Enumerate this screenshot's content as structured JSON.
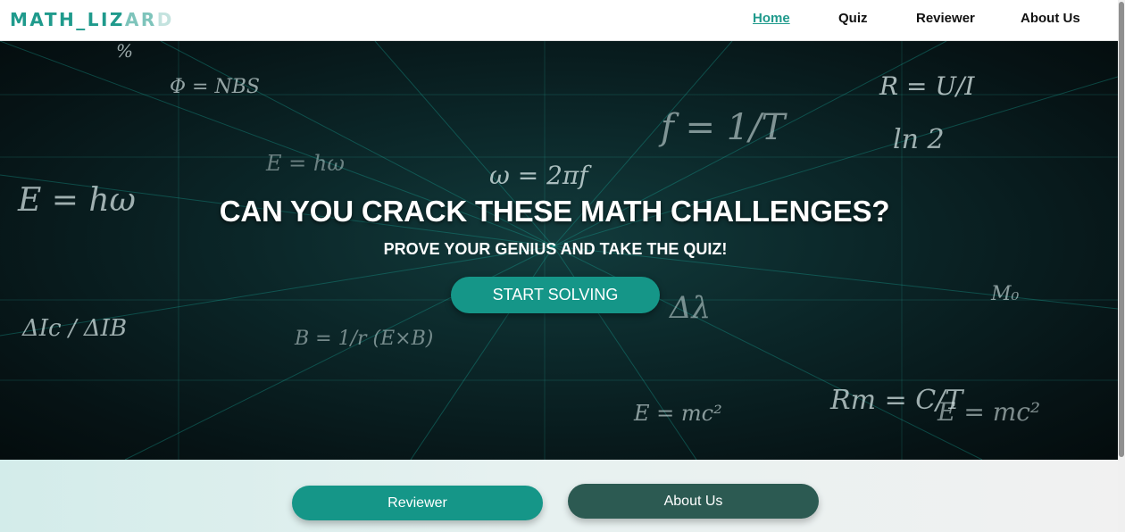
{
  "header": {
    "logo_main": "MATH_LIZ",
    "logo_fade1": "AR",
    "logo_fade2": "D",
    "nav": [
      {
        "label": "Home",
        "active": true
      },
      {
        "label": "Quiz",
        "active": false
      },
      {
        "label": "Reviewer",
        "active": false
      },
      {
        "label": "About Us",
        "active": false
      }
    ]
  },
  "hero": {
    "title": "CAN YOU CRACK THESE MATH CHALLENGES?",
    "subtitle": "PROVE YOUR GENIUS AND TAKE THE QUIZ!",
    "cta_label": "START SOLVING",
    "background_formulas": [
      "%",
      "Φ = NBS",
      "R = U/I",
      "E = hω",
      "ω = 2πf",
      "f = 1/T",
      "ln 2",
      "E = mc²",
      "ΔIc / ΔIB",
      "B = 1/r (E×B)",
      "Rm = C/T",
      "M₀",
      "Δλ"
    ]
  },
  "bottom": {
    "reviewer_label": "Reviewer",
    "about_label": "About Us"
  },
  "colors": {
    "accent": "#1f9a8c",
    "button_teal": "#159688",
    "button_dark": "#2c5a52",
    "hero_bg": "#0b2628"
  }
}
